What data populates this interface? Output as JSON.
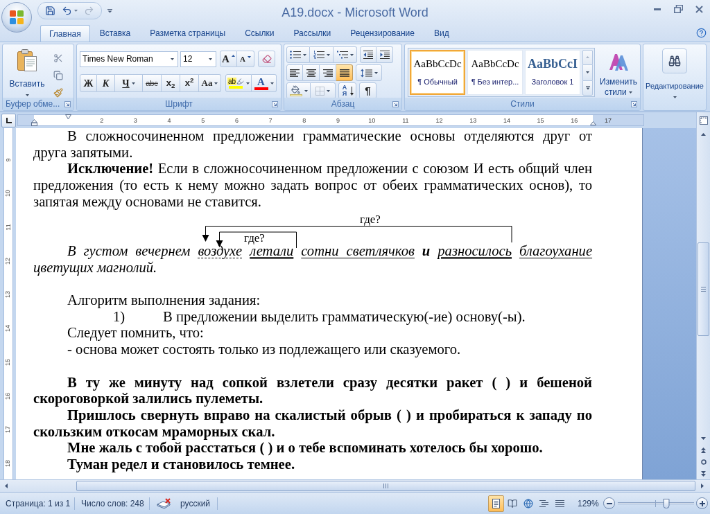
{
  "window": {
    "title": "A19.docx - Microsoft Word"
  },
  "quick_access": [
    {
      "kind": "save",
      "disabled": false
    },
    {
      "kind": "undo",
      "disabled": false
    },
    {
      "kind": "redo",
      "disabled": true
    }
  ],
  "tabs": [
    {
      "label": "Главная",
      "selected": true
    },
    {
      "label": "Вставка",
      "selected": false
    },
    {
      "label": "Разметка страницы",
      "selected": false
    },
    {
      "label": "Ссылки",
      "selected": false
    },
    {
      "label": "Рассылки",
      "selected": false
    },
    {
      "label": "Рецензирование",
      "selected": false
    },
    {
      "label": "Вид",
      "selected": false
    }
  ],
  "ribbon": {
    "clipboard": {
      "label": "Буфер обме...",
      "paste": "Вставить"
    },
    "font": {
      "label": "Шрифт",
      "font_name": "Times New Roman",
      "font_size": "12",
      "grow": "A",
      "shrink": "A",
      "format_buttons": [
        {
          "kind": "bold",
          "text": "Ж"
        },
        {
          "kind": "italic",
          "text": "К"
        },
        {
          "kind": "underline",
          "text": "Ч"
        },
        {
          "kind": "strikethrough",
          "text": "abc"
        },
        {
          "kind": "subscript",
          "text": "x$_{2}$"
        },
        {
          "kind": "superscript",
          "text": "x$^{2}$"
        },
        {
          "kind": "case",
          "text": "Aa"
        }
      ],
      "highlight": "ab",
      "font_color": "A"
    },
    "paragraph": {
      "label": "Абзац",
      "alignments": [
        {
          "kind": "left",
          "selected": false
        },
        {
          "kind": "center",
          "selected": false
        },
        {
          "kind": "right",
          "selected": false
        },
        {
          "kind": "justify",
          "selected": true
        }
      ],
      "sort": "АЯ",
      "show_marks": "¶"
    },
    "styles": {
      "label": "Стили",
      "items": [
        {
          "kind": "normal",
          "preview": "AaBbCcDc",
          "name": "¶ Обычный",
          "selected": true
        },
        {
          "kind": "normal",
          "preview": "AaBbCcDc",
          "name": "¶ Без интер...",
          "selected": false
        },
        {
          "kind": "heading",
          "preview": "AaBbCcI",
          "name": "Заголовок 1",
          "selected": false
        }
      ],
      "change_styles": "Изменить стили"
    },
    "editing": {
      "label": "Редактирование"
    }
  },
  "ruler": {
    "numbers": [
      "2",
      "3",
      "4",
      "5",
      "6",
      "7",
      "8",
      "9",
      "10",
      "11",
      "12",
      "13",
      "14",
      "15",
      "16",
      "17"
    ]
  },
  "vertical_ruler": {
    "numbers": [
      "9",
      "10",
      "11",
      "12",
      "13",
      "14",
      "15",
      "16",
      "17",
      "18"
    ]
  },
  "document": {
    "paragraphs": [
      {
        "kind": "body",
        "text": "В сложносочиненном предложении грамматические основы отделяются друг от друга запятыми."
      },
      {
        "kind": "body",
        "text": "**Исключение!** Если в сложносочиненном предложении с союзом И есть общий член предложения (то есть к нему можно задать вопрос от обеих грамматических основ), то запятая между основами не ставится."
      },
      {
        "kind": "diagram",
        "labels": [
          "где?",
          "где?"
        ]
      },
      {
        "kind": "example",
        "segments": [
          {
            "text": "В густом вечернем",
            "kind": "plain"
          },
          {
            "text": "воздухе",
            "kind": "dashdot"
          },
          {
            "text": "летали",
            "kind": "double"
          },
          {
            "text": "сотни светлячков",
            "kind": "single"
          },
          {
            "text": "и",
            "kind": "bold"
          },
          {
            "text": "разносилось",
            "kind": "double"
          },
          {
            "text": "благоухание",
            "kind": "single"
          },
          {
            "text": "цветущих магнолий.",
            "kind": "plain"
          }
        ]
      },
      {
        "kind": "blank"
      },
      {
        "kind": "line",
        "text": "Алгоритм выполнения задания:"
      },
      {
        "kind": "numbered",
        "marker": "1)",
        "text": "В предложении выделить грамматическую(-ие) основу(-ы)."
      },
      {
        "kind": "line",
        "text": "Следует помнить, что:"
      },
      {
        "kind": "line",
        "text": "- основа может состоять только из подлежащего или сказуемого."
      },
      {
        "kind": "blank"
      },
      {
        "kind": "exercise",
        "text": "В ту же минуту над сопкой взлетели сразу десятки ракет ( ) и бешеной скороговоркой залились пулеметы."
      },
      {
        "kind": "exercise",
        "text": "Пришлось свернуть вправо на скалистый обрыв ( ) и пробираться к западу по скользким откосам мраморных скал."
      },
      {
        "kind": "exercise",
        "text": "Мне жаль с тобой расстаться ( ) и о тебе вспоминать хотелось бы хорошо."
      },
      {
        "kind": "exercise",
        "text": "Туман редел и становилось темнее."
      }
    ]
  },
  "status_bar": {
    "page": "Страница: 1 из 1",
    "words": "Число слов: 248",
    "language": "русский",
    "views": [
      {
        "kind": "print",
        "selected": true
      },
      {
        "kind": "reading",
        "selected": false
      },
      {
        "kind": "web",
        "selected": false
      },
      {
        "kind": "outline",
        "selected": false
      },
      {
        "kind": "draft",
        "selected": false
      }
    ],
    "zoom": "129%",
    "zoom_slider": {
      "level": 0.64
    }
  }
}
